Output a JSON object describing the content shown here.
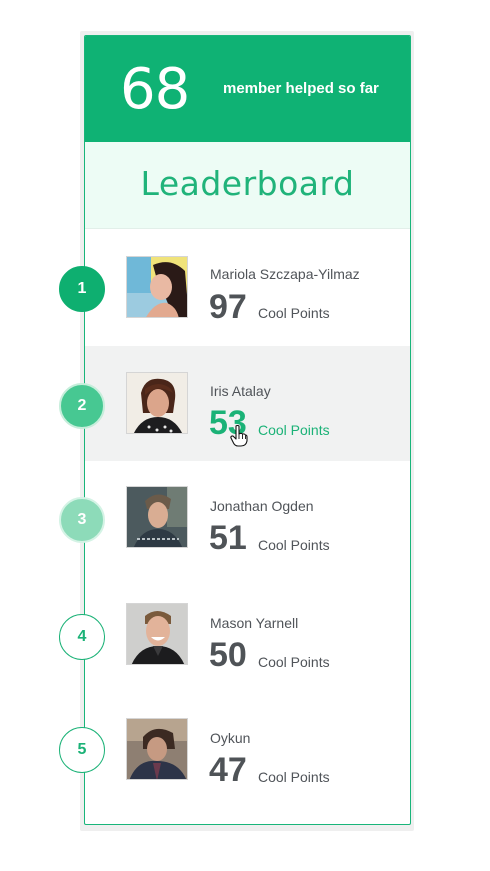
{
  "header": {
    "count": "68",
    "caption": "member helped so far",
    "bg_color": "#0fb274"
  },
  "title": "Leaderboard",
  "accent_color": "#1bb277",
  "points_label": "Cool Points",
  "leaders": [
    {
      "rank": "1",
      "name": "Mariola Szczapa-Yilmaz",
      "points": "97",
      "avatar": "woman-portrait-avatar"
    },
    {
      "rank": "2",
      "name": "Iris Atalay",
      "points": "53",
      "avatar": "woman-short-hair-avatar",
      "highlighted": true
    },
    {
      "rank": "3",
      "name": "Jonathan Ogden",
      "points": "51",
      "avatar": "man-sweater-avatar"
    },
    {
      "rank": "4",
      "name": "Mason Yarnell",
      "points": "50",
      "avatar": "man-smiling-avatar"
    },
    {
      "rank": "5",
      "name": "Oykun",
      "points": "47",
      "avatar": "man-dark-jacket-avatar"
    }
  ]
}
